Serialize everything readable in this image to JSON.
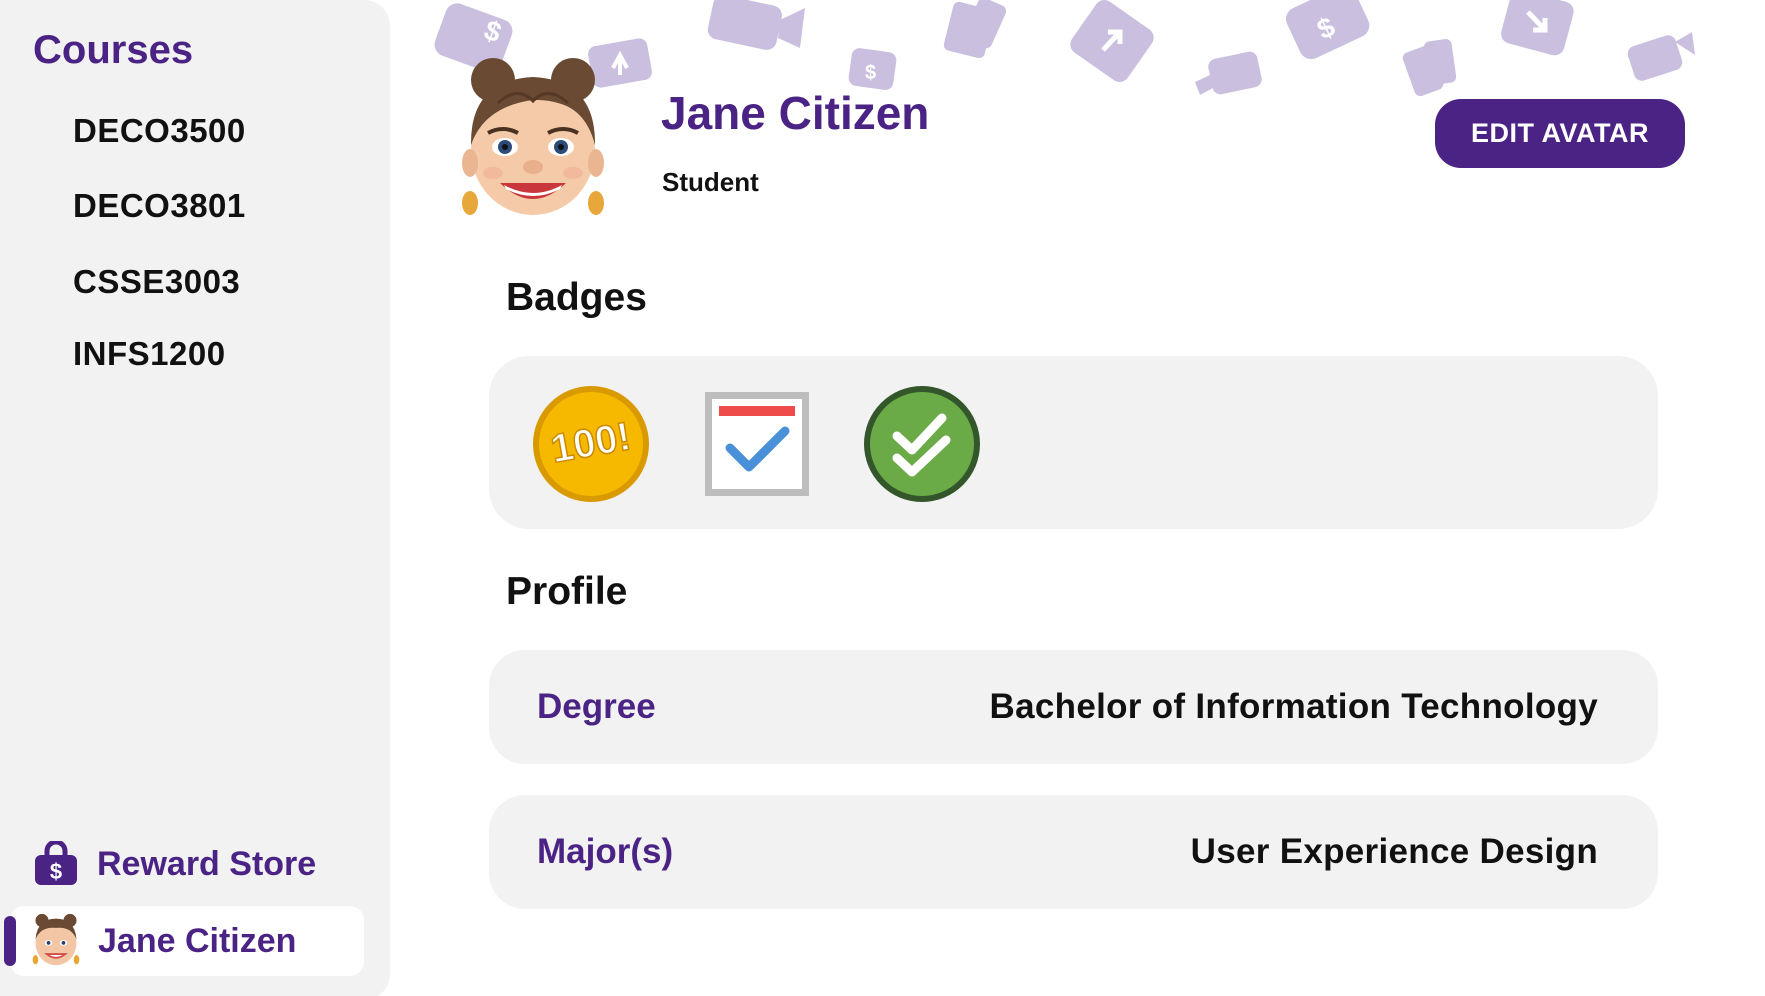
{
  "sidebar": {
    "heading": "Courses",
    "courses": [
      "DECO3500",
      "DECO3801",
      "CSSE3003",
      "INFS1200"
    ],
    "reward_store_label": "Reward Store",
    "user_label": "Jane Citizen"
  },
  "header": {
    "name": "Jane Citizen",
    "role": "Student",
    "edit_avatar_label": "EDIT AVATAR"
  },
  "badges": {
    "title": "Badges",
    "items": [
      {
        "icon": "hundred-badge-icon",
        "text": "100!"
      },
      {
        "icon": "calendar-check-badge-icon"
      },
      {
        "icon": "double-check-badge-icon"
      }
    ]
  },
  "profile": {
    "title": "Profile",
    "rows": [
      {
        "key": "Degree",
        "value": "Bachelor of Information Technology"
      },
      {
        "key": "Major(s)",
        "value": "User Experience Design"
      }
    ]
  },
  "colors": {
    "accent": "#4a2384",
    "panel": "#f2f2f2",
    "deco": "#c9bde0"
  }
}
